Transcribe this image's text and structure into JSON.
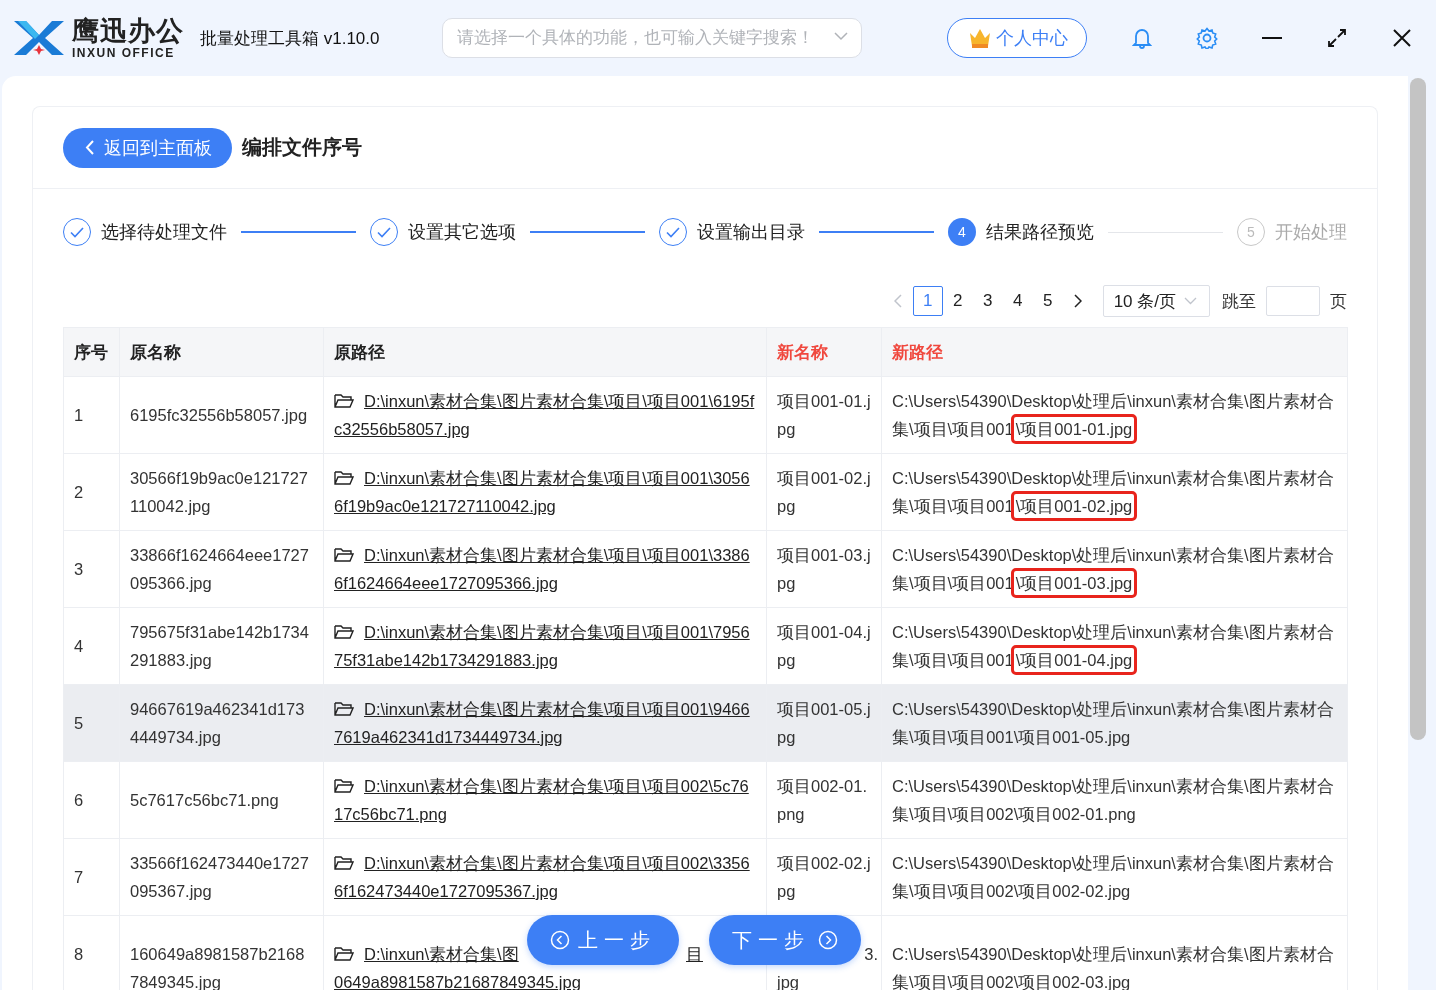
{
  "header": {
    "logo_text": "鹰迅办公",
    "logo_subtext": "INXUN OFFICE",
    "app_title": "批量处理工具箱 v1.10.0",
    "search": {
      "placeholder": "请选择一个具体的功能，也可输入关键字搜索！"
    },
    "user_button": "个人中心"
  },
  "page": {
    "back_button": "返回到主面板",
    "title": "编排文件序号"
  },
  "steps": [
    {
      "label": "选择待处理文件",
      "kind": "done"
    },
    {
      "label": "设置其它选项",
      "kind": "done"
    },
    {
      "label": "设置输出目录",
      "kind": "done"
    },
    {
      "number": "4",
      "label": "结果路径预览",
      "kind": "active"
    },
    {
      "number": "5",
      "label": "开始处理",
      "kind": "pending"
    }
  ],
  "pagination": {
    "pages": [
      {
        "label": "1",
        "selected": true
      },
      {
        "label": "2",
        "selected": false
      },
      {
        "label": "3",
        "selected": false
      },
      {
        "label": "4",
        "selected": false
      },
      {
        "label": "5",
        "selected": false
      }
    ],
    "page_size": "10 条/页",
    "jump_label": "跳至",
    "page_unit": "页"
  },
  "table": {
    "columns": [
      {
        "label": "序号",
        "accent": false
      },
      {
        "label": "原名称",
        "accent": false
      },
      {
        "label": "原路径",
        "accent": false
      },
      {
        "label": "新名称",
        "accent": true
      },
      {
        "label": "新路径",
        "accent": true
      }
    ],
    "rows": [
      {
        "index": "1",
        "name": "6195fc32556b58057.jpg",
        "path": "D:\\inxun\\素材合集\\图片素材合集\\项目\\项目001\\6195fc32556b58057.jpg",
        "new_name": "项目001-01.jpg",
        "new_dir": "C:\\Users\\54390\\Desktop\\处理后\\inxun\\素材合集\\图片素材合集\\项目\\项目001",
        "new_file": "\\项目001-01.jpg",
        "highlighted": true,
        "selected": false
      },
      {
        "index": "2",
        "name": "30566f19b9ac0e121727110042.jpg",
        "path": "D:\\inxun\\素材合集\\图片素材合集\\项目\\项目001\\30566f19b9ac0e121727110042.jpg",
        "new_name": "项目001-02.jpg",
        "new_dir": "C:\\Users\\54390\\Desktop\\处理后\\inxun\\素材合集\\图片素材合集\\项目\\项目001",
        "new_file": "\\项目001-02.jpg",
        "highlighted": true,
        "selected": false
      },
      {
        "index": "3",
        "name": "33866f1624664eee1727095366.jpg",
        "path": "D:\\inxun\\素材合集\\图片素材合集\\项目\\项目001\\33866f1624664eee1727095366.jpg",
        "new_name": "项目001-03.jpg",
        "new_dir": "C:\\Users\\54390\\Desktop\\处理后\\inxun\\素材合集\\图片素材合集\\项目\\项目001",
        "new_file": "\\项目001-03.jpg",
        "highlighted": true,
        "selected": false
      },
      {
        "index": "4",
        "name": "795675f31abe142b1734291883.jpg",
        "path": "D:\\inxun\\素材合集\\图片素材合集\\项目\\项目001\\795675f31abe142b1734291883.jpg",
        "new_name": "项目001-04.jpg",
        "new_dir": "C:\\Users\\54390\\Desktop\\处理后\\inxun\\素材合集\\图片素材合集\\项目\\项目001",
        "new_file": "\\项目001-04.jpg",
        "highlighted": true,
        "selected": false
      },
      {
        "index": "5",
        "name": "94667619a462341d1734449734.jpg",
        "path": "D:\\inxun\\素材合集\\图片素材合集\\项目\\项目001\\94667619a462341d1734449734.jpg",
        "new_name": "项目001-05.jpg",
        "new_dir": "C:\\Users\\54390\\Desktop\\处理后\\inxun\\素材合集\\图片素材合集\\项目\\项目001",
        "new_file": "\\项目001-05.jpg",
        "highlighted": false,
        "selected": true
      },
      {
        "index": "6",
        "name": "5c7617c56bc71.png",
        "path": "D:\\inxun\\素材合集\\图片素材合集\\项目\\项目002\\5c7617c56bc71.png",
        "new_name": "项目002-01.png",
        "new_dir": "C:\\Users\\54390\\Desktop\\处理后\\inxun\\素材合集\\图片素材合集\\项目\\项目002",
        "new_file": "\\项目002-01.png",
        "highlighted": false,
        "selected": false
      },
      {
        "index": "7",
        "name": "33566f162473440e1727095367.jpg",
        "path": "D:\\inxun\\素材合集\\图片素材合集\\项目\\项目002\\33566f162473440e1727095367.jpg",
        "new_name": "项目002-02.jpg",
        "new_dir": "C:\\Users\\54390\\Desktop\\处理后\\inxun\\素材合集\\图片素材合集\\项目\\项目002",
        "new_file": "\\项目002-02.jpg",
        "highlighted": false,
        "selected": false
      },
      {
        "kind": "partial",
        "index": "8",
        "name": "160649a8981587b21687849345.jpg",
        "path_pieces": [
          "D:\\inxun\\素材合集\\图",
          "目"
        ],
        "path_line2": "0649a8981587b21687849345.jpg",
        "new_name_pieces": [
          "3.",
          "jpg"
        ],
        "new_dir": "C:\\Users\\54390\\Desktop\\处理后\\inxun\\素材合集\\图片素材合集\\项目\\项目002",
        "new_file": "\\项目002-03.jpg",
        "highlighted": false,
        "selected": false
      }
    ]
  },
  "nav": {
    "prev": "上一步",
    "next": "下一步"
  }
}
